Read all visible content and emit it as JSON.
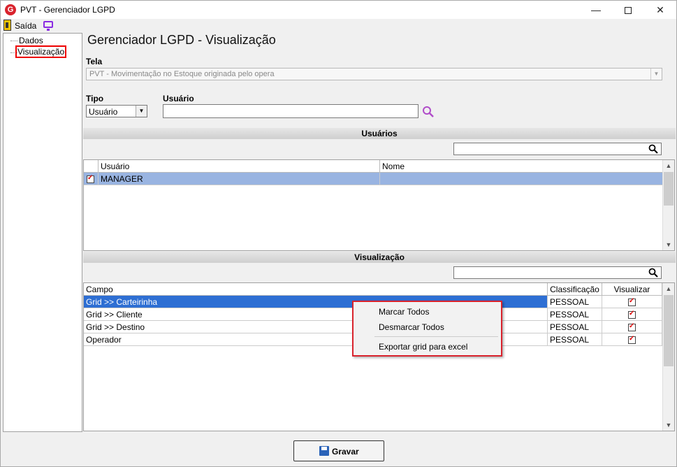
{
  "window": {
    "title": "PVT - Gerenciador LGPD",
    "logo_letter": "G",
    "min_glyph": "—",
    "close_glyph": "✕"
  },
  "toolbar": {
    "exit_label": "Saída",
    "icons": [
      "exit-icon",
      "monitor-icon"
    ]
  },
  "tree": {
    "items": [
      "Dados",
      "Visualização"
    ],
    "selected": "Visualização"
  },
  "page": {
    "title": "Gerenciador LGPD - Visualização"
  },
  "form": {
    "tela_label": "Tela",
    "tela_value": "PVT - Movimentação no Estoque originada pelo opera",
    "tipo_label": "Tipo",
    "tipo_value": "Usuário",
    "usuario_label": "Usuário",
    "usuario_value": ""
  },
  "users_section": {
    "header": "Usuários",
    "columns": [
      "Usuário",
      "Nome"
    ],
    "rows": [
      {
        "checked": true,
        "usuario": "MANAGER",
        "nome": ""
      }
    ]
  },
  "view_section": {
    "header": "Visualização",
    "columns": [
      "Campo",
      "Classificação",
      "Visualizar"
    ],
    "rows": [
      {
        "campo": "Grid >> Carteirinha",
        "classificacao": "PESSOAL",
        "visualizar": true
      },
      {
        "campo": "Grid >> Cliente",
        "classificacao": "PESSOAL",
        "visualizar": true
      },
      {
        "campo": "Grid >> Destino",
        "classificacao": "PESSOAL",
        "visualizar": true
      },
      {
        "campo": "Operador",
        "classificacao": "PESSOAL",
        "visualizar": true
      }
    ]
  },
  "context_menu": {
    "items": [
      "Marcar Todos",
      "Desmarcar Todos",
      "Exportar grid para excel"
    ]
  },
  "footer": {
    "save_label": "Gravar"
  },
  "colors": {
    "accent_red": "#d9232d",
    "selected_row": "#99b4e1",
    "selected_row_active": "#2e6fd3",
    "search_icon_purple": "#b04cc9"
  }
}
